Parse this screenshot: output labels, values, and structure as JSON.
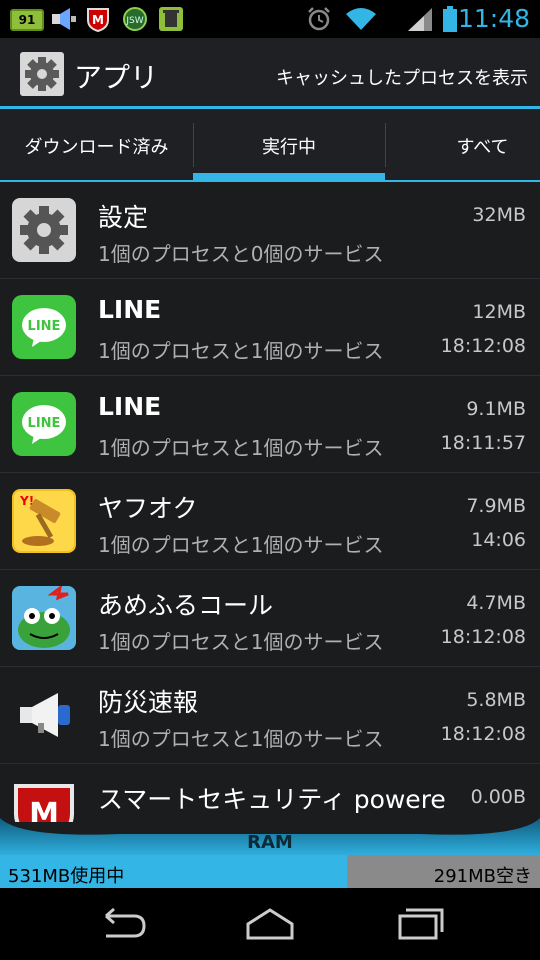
{
  "status_bar": {
    "battery_badge": "91",
    "time": "11:48",
    "icons": [
      "battery-notification-icon",
      "speaker-notification-icon",
      "mcafee-icon",
      "jsw-icon",
      "trash-icon",
      "alarm-icon",
      "wifi-icon",
      "signal-icon",
      "battery-icon"
    ]
  },
  "action_bar": {
    "title": "アプリ",
    "action": "キャッシュしたプロセスを表示"
  },
  "tabs": [
    {
      "label": "ダウンロード済み",
      "selected": false
    },
    {
      "label": "実行中",
      "selected": true
    },
    {
      "label": "すべて",
      "selected": false
    }
  ],
  "apps": [
    {
      "name": "設定",
      "sub": "1個のプロセスと0個のサービス",
      "size": "32MB",
      "time": "",
      "icon": "settings-icon",
      "bold": false
    },
    {
      "name": "LINE",
      "sub": "1個のプロセスと1個のサービス",
      "size": "12MB",
      "time": "18:12:08",
      "icon": "line-icon",
      "bold": true
    },
    {
      "name": "LINE",
      "sub": "1個のプロセスと1個のサービス",
      "size": "9.1MB",
      "time": "18:11:57",
      "icon": "line-icon",
      "bold": true
    },
    {
      "name": "ヤフオク",
      "sub": "1個のプロセスと1個のサービス",
      "size": "7.9MB",
      "time": "14:06",
      "icon": "yahoo-auction-icon",
      "bold": false
    },
    {
      "name": "あめふるコール",
      "sub": "1個のプロセスと1個のサービス",
      "size": "4.7MB",
      "time": "18:12:08",
      "icon": "frog-icon",
      "bold": false
    },
    {
      "name": "防災速報",
      "sub": "1個のプロセスと1個のサービス",
      "size": "5.8MB",
      "time": "18:12:08",
      "icon": "megaphone-icon",
      "bold": false
    },
    {
      "name": "スマートセキュリティ powere",
      "sub": "",
      "size": "0.00B",
      "time": "",
      "icon": "mcafee-shield-icon",
      "bold": false
    }
  ],
  "ram": {
    "label": "RAM",
    "used": "531MB使用中",
    "free": "291MB空き",
    "used_fraction": 0.646
  },
  "colors": {
    "accent": "#33b5e5",
    "background": "#1b1c1e",
    "line_green": "#3fc43f"
  }
}
